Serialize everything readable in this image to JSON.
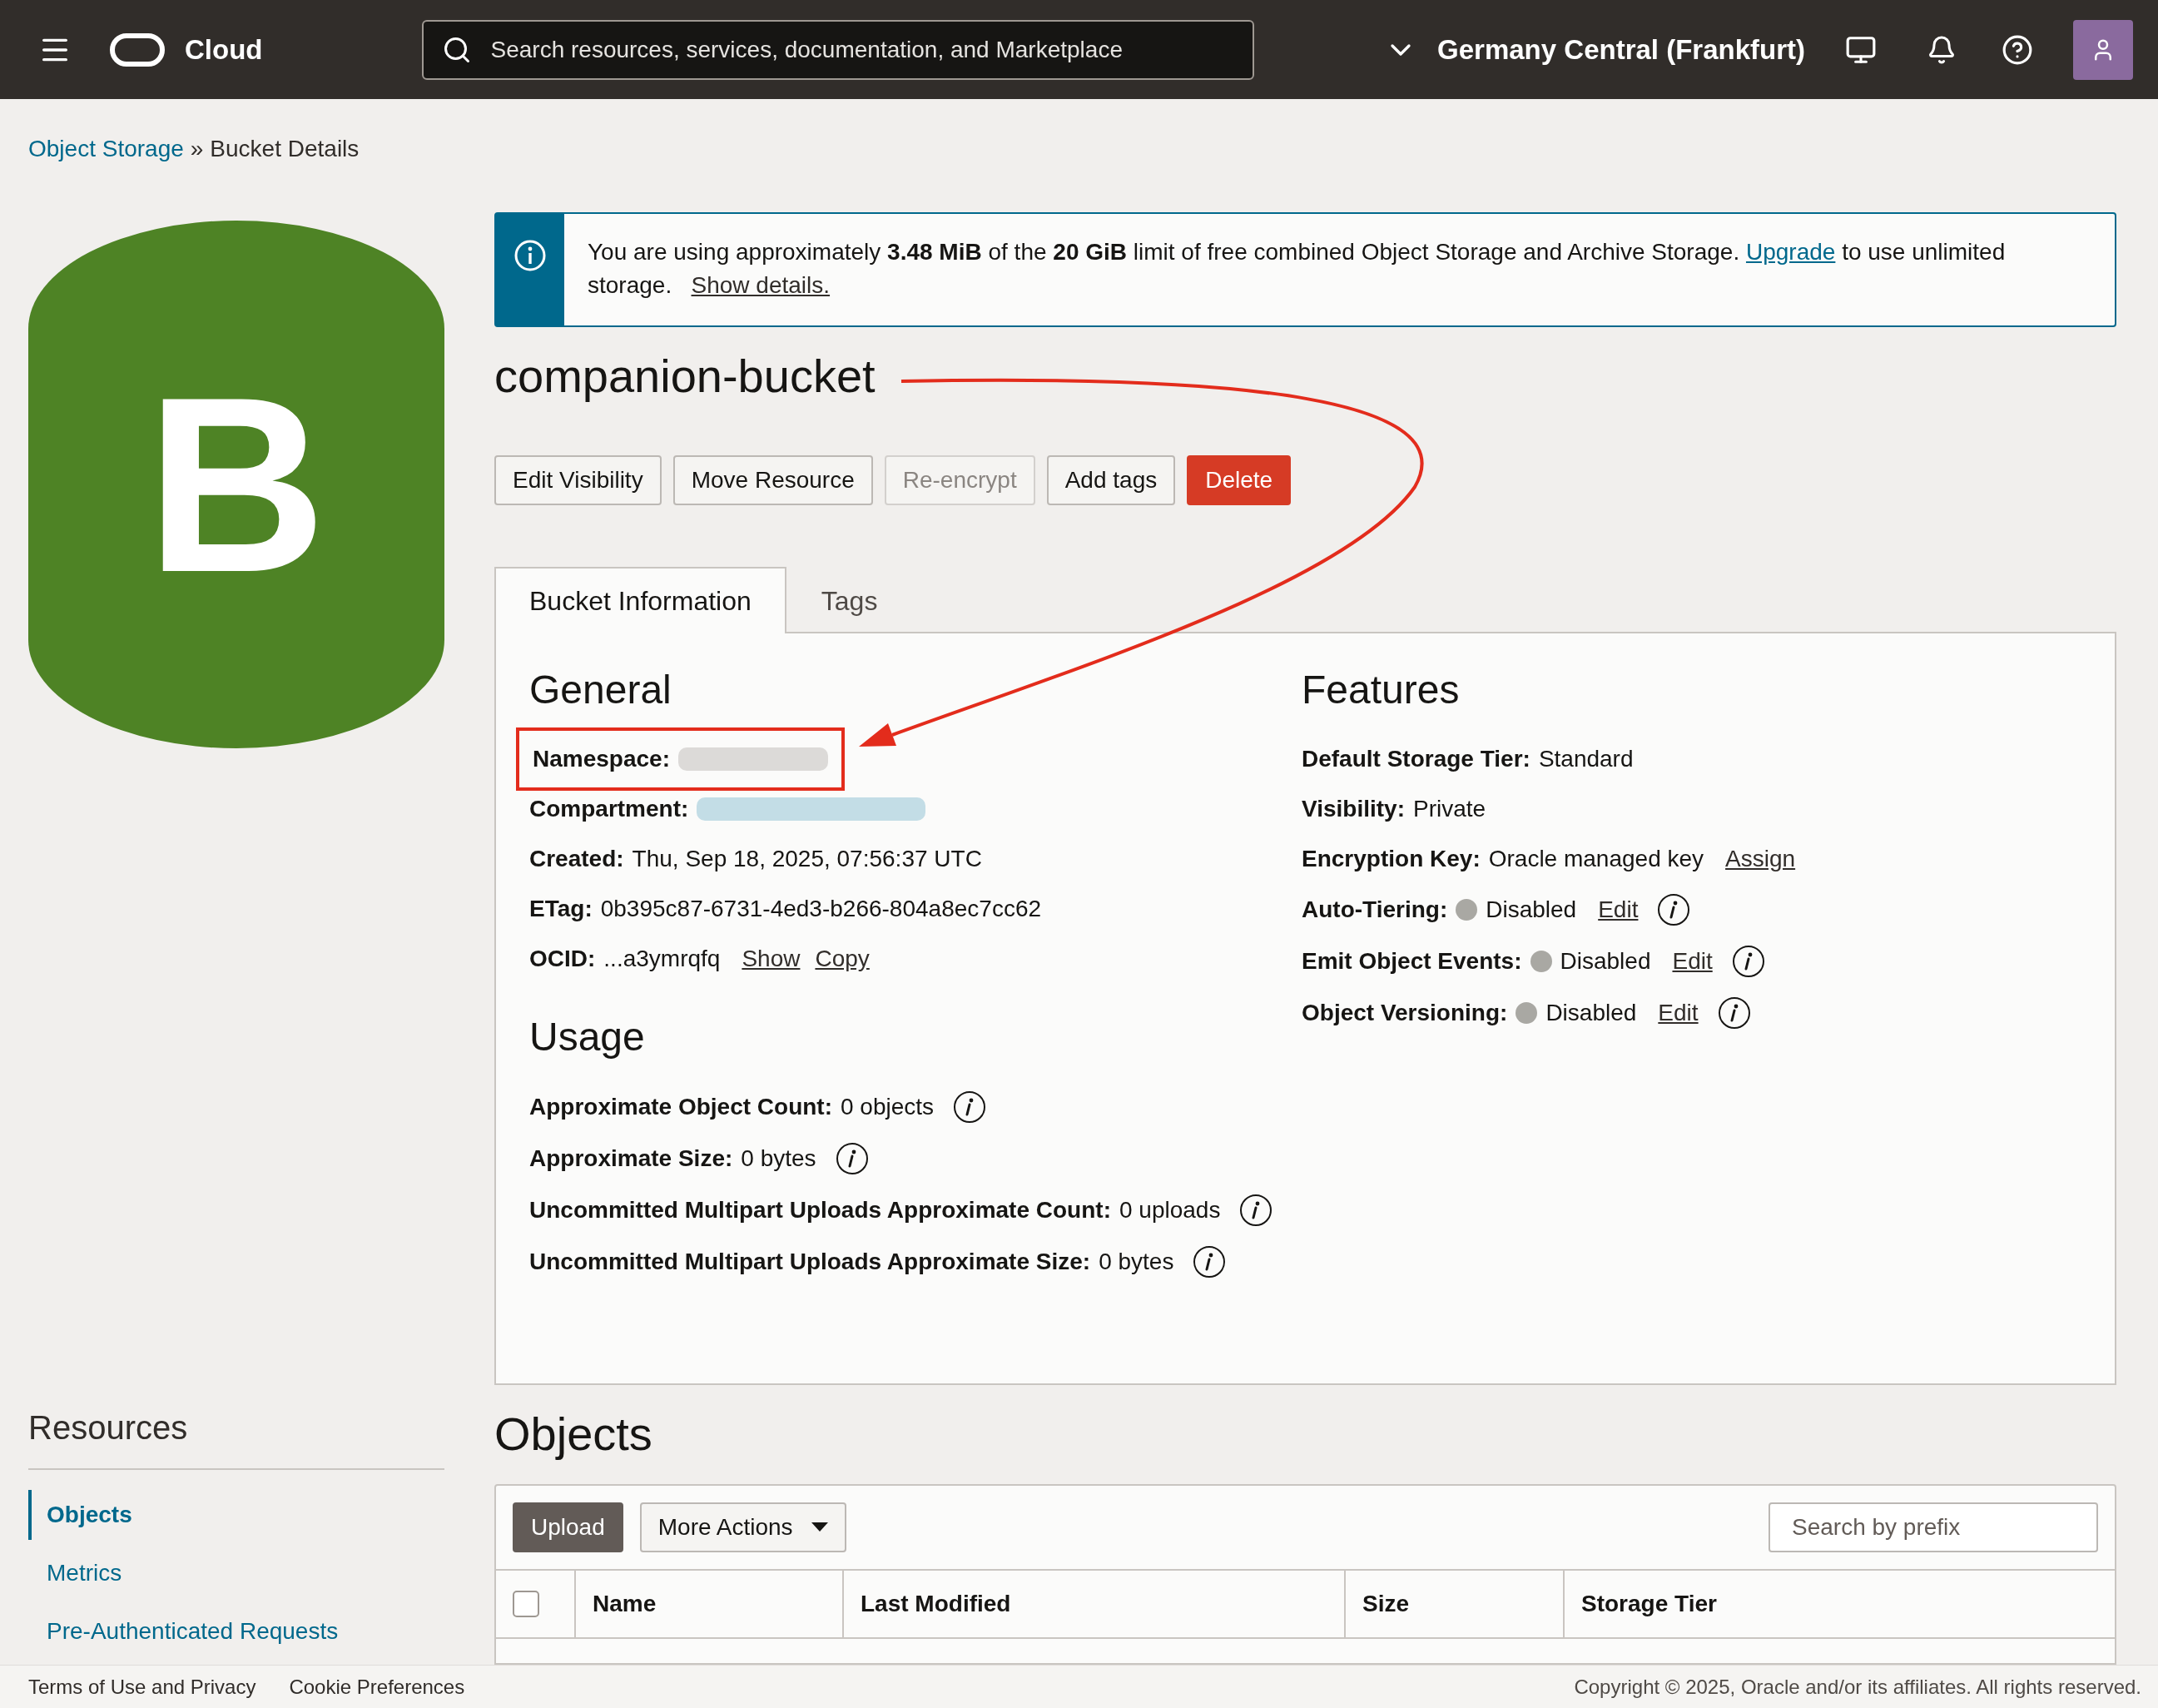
{
  "header": {
    "brand": "Cloud",
    "search": {
      "placeholder": "Search resources, services, documentation, and Marketplace"
    },
    "region": "Germany Central (Frankfurt)"
  },
  "breadcrumb": {
    "items": [
      {
        "label": "Object Storage",
        "kind": "link"
      },
      {
        "label": "Bucket Details",
        "kind": "current"
      }
    ],
    "separator": "»"
  },
  "bucket_icon": {
    "letter": "B"
  },
  "banner": {
    "text": "You are using approximately **3.48 MiB** of the **20 GiB** limit of free combined Object Storage and Archive Storage.",
    "link": "Upgrade",
    "text_after": "to use unlimited storage.",
    "details_link": "Show details."
  },
  "title": "companion-bucket",
  "callout_arrow": true,
  "actions": [
    {
      "label": "Edit Visibility",
      "kind": "default",
      "disabled": false
    },
    {
      "label": "Move Resource",
      "kind": "default",
      "disabled": false
    },
    {
      "label": "Re-encrypt",
      "kind": "default",
      "disabled": true
    },
    {
      "label": "Add tags",
      "kind": "default",
      "disabled": false
    },
    {
      "label": "Delete",
      "kind": "danger",
      "disabled": false
    }
  ],
  "tabs": [
    {
      "label": "Bucket Information",
      "selected": true
    },
    {
      "label": "Tags",
      "selected": false
    }
  ],
  "general": {
    "heading": "General",
    "fields": [
      {
        "label": "Namespace:",
        "kind": "redacted",
        "color": "#dcdad8",
        "highlighted": true
      },
      {
        "label": "Compartment:",
        "kind": "redacted",
        "color": "#c3dde6",
        "highlighted": false
      },
      {
        "label": "Created:",
        "kind": "text",
        "value": "Thu, Sep 18, 2025, 07:56:37 UTC",
        "highlighted": false
      },
      {
        "label": "ETag:",
        "kind": "text",
        "value": "0b395c87-6731-4ed3-b266-804a8ec7cc62",
        "highlighted": false
      },
      {
        "label": "OCID:",
        "kind": "text",
        "value": "...a3ymrqfq",
        "links": [
          "Show",
          "Copy"
        ],
        "highlighted": false
      }
    ]
  },
  "usage": {
    "heading": "Usage",
    "fields": [
      {
        "label": "Approximate Object Count:",
        "value": "0 objects",
        "info": true
      },
      {
        "label": "Approximate Size:",
        "value": "0 bytes",
        "info": true
      },
      {
        "label": "Uncommitted Multipart Uploads Approximate Count:",
        "value": "0 uploads",
        "info": true
      },
      {
        "label": "Uncommitted Multipart Uploads Approximate Size:",
        "value": "0 bytes",
        "info": true
      }
    ]
  },
  "features": {
    "heading": "Features",
    "fields": [
      {
        "label": "Default Storage Tier:",
        "value": "Standard",
        "info": false
      },
      {
        "label": "Visibility:",
        "value": "Private",
        "info": false
      },
      {
        "label": "Encryption Key:",
        "value": "Oracle managed key",
        "links": [
          "Assign"
        ],
        "info": false
      },
      {
        "label": "Auto-Tiering:",
        "value": "Disabled",
        "color": "#a9a8a3",
        "links": [
          "Edit"
        ],
        "info": true
      },
      {
        "label": "Emit Object Events:",
        "value": "Disabled",
        "color": "#a9a8a3",
        "links": [
          "Edit"
        ],
        "info": true
      },
      {
        "label": "Object Versioning:",
        "value": "Disabled",
        "color": "#a9a8a3",
        "links": [
          "Edit"
        ],
        "info": true
      }
    ]
  },
  "resources": {
    "heading": "Resources",
    "items": [
      {
        "label": "Objects",
        "selected": true
      },
      {
        "label": "Metrics",
        "selected": false
      },
      {
        "label": "Pre-Authenticated Requests",
        "selected": false
      }
    ]
  },
  "objects": {
    "heading": "Objects",
    "actions": [
      {
        "label": "Upload",
        "kind": "primary"
      },
      {
        "label": "More Actions",
        "kind": "menu"
      }
    ],
    "search": {
      "placeholder": "Search by prefix"
    },
    "select_all": {
      "checked": false
    },
    "columns": [
      "Name",
      "Last Modified",
      "Size",
      "Storage Tier"
    ]
  },
  "footer": {
    "links": [
      "Terms of Use and Privacy",
      "Cookie Preferences"
    ],
    "copyright": "Copyright © 2025, Oracle and/or its affiliates. All rights reserved."
  }
}
